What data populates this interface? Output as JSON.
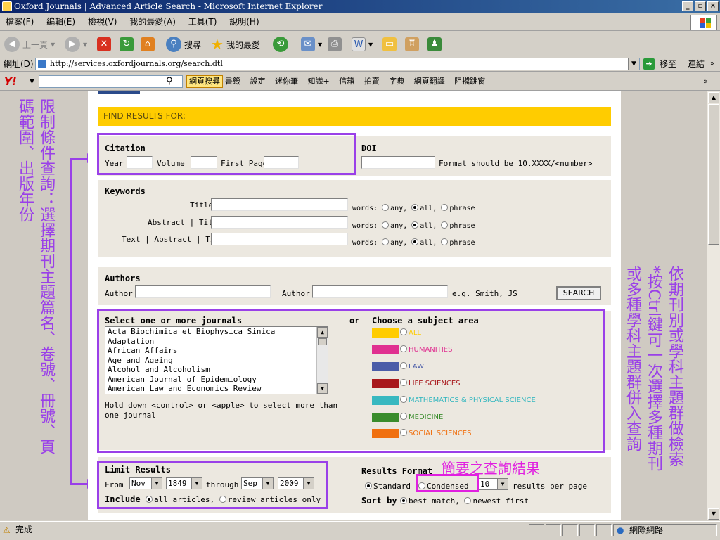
{
  "window": {
    "title": "Oxford Journals | Advanced Article Search - Microsoft Internet Explorer"
  },
  "menu": [
    "檔案(F)",
    "編輯(E)",
    "檢視(V)",
    "我的最愛(A)",
    "工具(T)",
    "說明(H)"
  ],
  "toolbar": {
    "back": "上一頁",
    "search": "搜尋",
    "favorites": "我的最愛"
  },
  "address": {
    "label": "網址(D)",
    "url": "http://services.oxfordjournals.org/search.dtl",
    "go": "移至",
    "links": "連結"
  },
  "yahoo": {
    "search_btn": "網頁搜尋",
    "items": [
      "書籤",
      "設定",
      "迷你筆",
      "知識+",
      "信箱",
      "拍賣",
      "字典",
      "網頁翻譯",
      "阻擋跳窗"
    ]
  },
  "form": {
    "header": "FIND RESULTS FOR:",
    "citation": {
      "title": "Citation",
      "year": "Year",
      "volume": "Volume",
      "first_page": "First Page"
    },
    "doi": {
      "title": "DOI",
      "hint": "Format should be 10.XXXX/<number>"
    },
    "keywords": {
      "title": "Keywords",
      "rows": [
        {
          "label": "Title"
        },
        {
          "label": "Abstract | Title"
        },
        {
          "label": "Text | Abstract | Title"
        }
      ],
      "words": "words:",
      "any": "any,",
      "all": "all,",
      "phrase": "phrase"
    },
    "authors": {
      "title": "Authors",
      "author1": "Author",
      "author2": "Author",
      "example": "e.g. Smith, JS",
      "search": "SEARCH"
    },
    "journals": {
      "title": "Select one or more journals",
      "items": [
        "Acta Biochimica et Biophysica Sinica",
        "Adaptation",
        "African Affairs",
        "Age and Ageing",
        "Alcohol and Alcoholism",
        "American Journal of Epidemiology",
        "American Law and Economics Review"
      ],
      "hold_note": "Hold down <control> or <apple> to select more than one journal",
      "or": "or"
    },
    "subjects": {
      "title": "Choose a subject area",
      "items": [
        {
          "label": "ALL",
          "color": "#ffcc00"
        },
        {
          "label": "HUMANITIES",
          "color": "#e03090"
        },
        {
          "label": "LAW",
          "color": "#4a5ca8"
        },
        {
          "label": "LIFE SCIENCES",
          "color": "#a8181c"
        },
        {
          "label": "MATHEMATICS & PHYSICAL SCIENCE",
          "color": "#38b8c0"
        },
        {
          "label": "MEDICINE",
          "color": "#3a8c2c"
        },
        {
          "label": "SOCIAL SCIENCES",
          "color": "#f07010"
        }
      ]
    },
    "limit": {
      "title": "Limit Results",
      "from": "From",
      "from_month": "Nov",
      "from_year": "1849",
      "through": "through",
      "to_month": "Sep",
      "to_year": "2009",
      "include": "Include",
      "all_articles": "all articles,",
      "review_only": "review articles only"
    },
    "format": {
      "title": "Results Format",
      "standard": "Standard",
      "condensed": "Condensed",
      "per_page_value": "10",
      "per_page": "results per page",
      "sort_by": "Sort by",
      "best_match": "best match,",
      "newest_first": "newest first"
    }
  },
  "annotations": {
    "left_col1": "碼範圍、出版年份",
    "left_col2": "限制條件查詢：選擇期刊主題篇名、卷號、冊號、頁",
    "right_col1": "依期刊別或學科主題群做檢索",
    "right_col2": "*按Ctrl鍵可一次選擇多種期刊",
    "right_col3": "或多種學科主題群併入查詢",
    "condensed_note": "簡要之查詢結果"
  },
  "status": {
    "text": "完成",
    "zone": "網際網路"
  }
}
